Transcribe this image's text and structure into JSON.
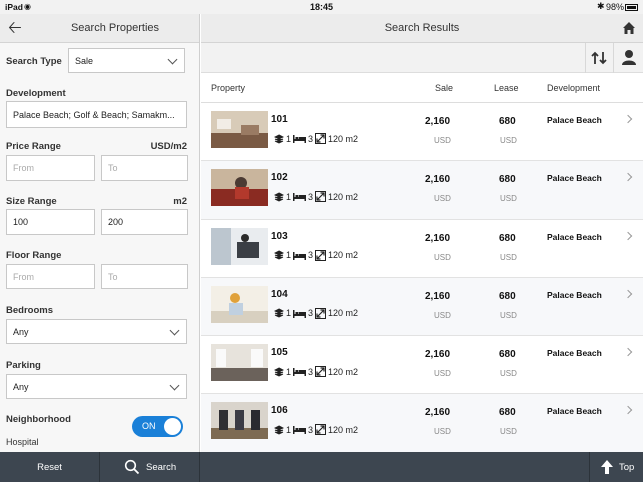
{
  "status": {
    "device": "iPad",
    "time": "18:45",
    "battery": "98%"
  },
  "left_panel": {
    "title": "Search Properties",
    "search_type": {
      "label": "Search Type",
      "value": "Sale"
    },
    "development": {
      "label": "Development",
      "value": "Palace Beach; Golf & Beach; Samakm..."
    },
    "price_range": {
      "label": "Price Range",
      "unit": "USD/m2",
      "from_placeholder": "From",
      "to_placeholder": "To"
    },
    "size_range": {
      "label": "Size Range",
      "unit": "m2",
      "from_value": "100",
      "to_value": "200"
    },
    "floor_range": {
      "label": "Floor Range",
      "from_placeholder": "From",
      "to_placeholder": "To"
    },
    "bedrooms": {
      "label": "Bedrooms",
      "value": "Any"
    },
    "parking": {
      "label": "Parking",
      "value": "Any"
    },
    "neighborhood": {
      "label": "Neighborhood",
      "hospital_label": "Hospital",
      "hospital_toggle": "ON"
    }
  },
  "right_panel": {
    "title": "Search Results",
    "columns": {
      "property": "Property",
      "sale": "Sale",
      "lease": "Lease",
      "development": "Development"
    },
    "rows": [
      {
        "unit": "101",
        "floors": "1",
        "beds": "3",
        "size": "120 m2",
        "sale": "2,160",
        "sale_cur": "USD",
        "lease": "680",
        "lease_cur": "USD",
        "development": "Palace Beach"
      },
      {
        "unit": "102",
        "floors": "1",
        "beds": "3",
        "size": "120 m2",
        "sale": "2,160",
        "sale_cur": "USD",
        "lease": "680",
        "lease_cur": "USD",
        "development": "Palace Beach"
      },
      {
        "unit": "103",
        "floors": "1",
        "beds": "3",
        "size": "120 m2",
        "sale": "2,160",
        "sale_cur": "USD",
        "lease": "680",
        "lease_cur": "USD",
        "development": "Palace Beach"
      },
      {
        "unit": "104",
        "floors": "1",
        "beds": "3",
        "size": "120 m2",
        "sale": "2,160",
        "sale_cur": "USD",
        "lease": "680",
        "lease_cur": "USD",
        "development": "Palace Beach"
      },
      {
        "unit": "105",
        "floors": "1",
        "beds": "3",
        "size": "120 m2",
        "sale": "2,160",
        "sale_cur": "USD",
        "lease": "680",
        "lease_cur": "USD",
        "development": "Palace Beach"
      },
      {
        "unit": "106",
        "floors": "1",
        "beds": "3",
        "size": "120 m2",
        "sale": "2,160",
        "sale_cur": "USD",
        "lease": "680",
        "lease_cur": "USD",
        "development": "Palace Beach"
      }
    ]
  },
  "bottom_bar": {
    "reset": "Reset",
    "search": "Search",
    "top": "Top"
  },
  "colors": {
    "accent": "#1a80d8",
    "bottom_bar": "#3d4650"
  }
}
